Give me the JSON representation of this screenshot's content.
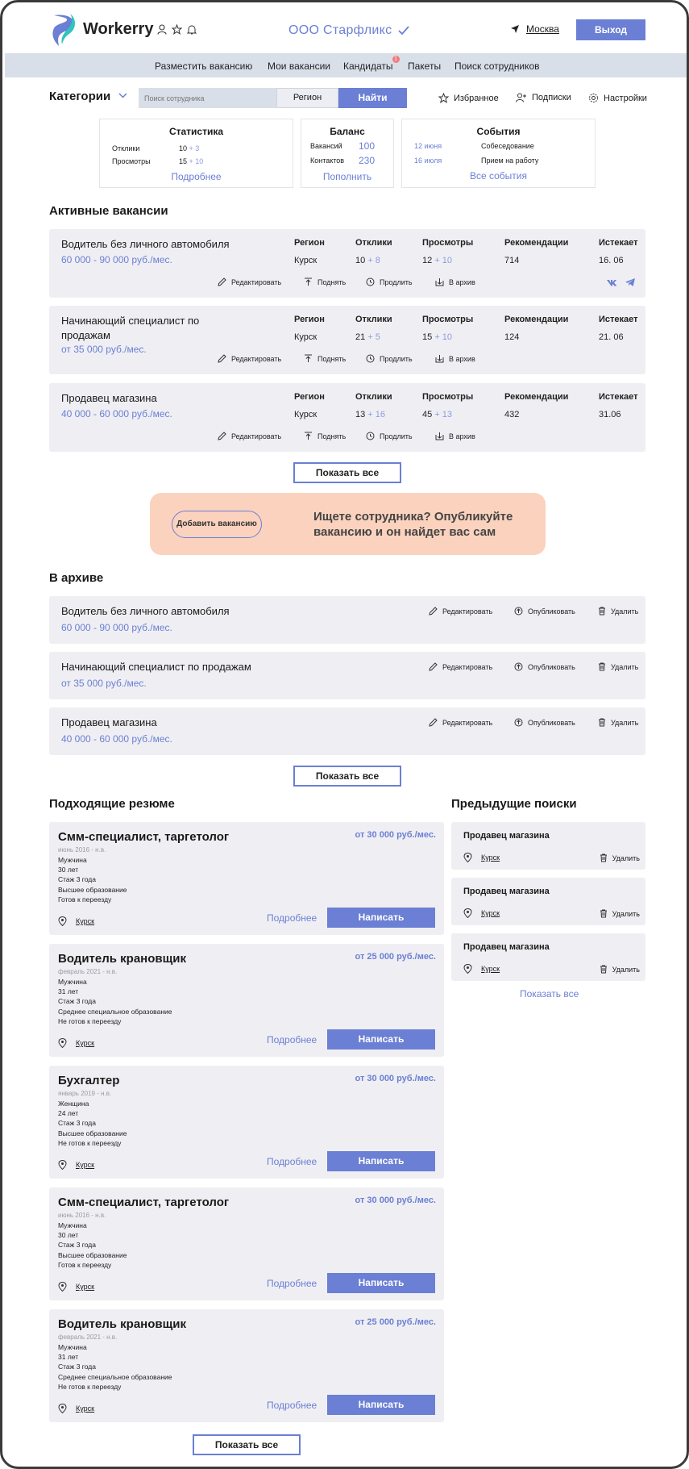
{
  "header": {
    "logo_text": "Workerry",
    "company": "ООО Старфликс",
    "city": "Москва",
    "exit_label": "Выход"
  },
  "nav": [
    "Разместить вакансию",
    "Мои вакансии",
    "Кандидаты",
    "Пакеты",
    "Поиск сотрудников"
  ],
  "nav_badge": "1",
  "search": {
    "categories_label": "Категории",
    "placeholder": "Поиск сотрудника",
    "region_label": "Регион",
    "find_label": "Найти",
    "favorites": "Избранное",
    "subscriptions": "Подписки",
    "settings": "Настройки"
  },
  "stats": {
    "title": "Статистика",
    "rows": [
      {
        "label": "Отклики",
        "value": "10",
        "delta": "+ 3"
      },
      {
        "label": "Просмотры",
        "value": "15",
        "delta": "+ 10"
      }
    ],
    "link": "Подробнее"
  },
  "balance": {
    "title": "Баланс",
    "rows": [
      {
        "label": "Вакансий",
        "value": "100"
      },
      {
        "label": "Контактов",
        "value": "230"
      }
    ],
    "link": "Пополнить"
  },
  "events": {
    "title": "События",
    "rows": [
      {
        "date": "12 июня",
        "name": "Собеседование"
      },
      {
        "date": "16 июля",
        "name": "Прием на работу"
      }
    ],
    "link": "Все события"
  },
  "active": {
    "title": "Активные вакансии",
    "columns": [
      "Регион",
      "Отклики",
      "Просмотры",
      "Рекомендации",
      "Истекает"
    ],
    "actions": [
      "Редактировать",
      "Поднять",
      "Продлить",
      "В архив"
    ],
    "items": [
      {
        "title": "Водитель без личного автомобиля",
        "salary": "60 000 - 90 000 руб./мес.",
        "region": "Курск",
        "responses": "10",
        "responses_delta": "+ 8",
        "views": "12",
        "views_delta": "+ 10",
        "recs": "714",
        "expires": "16. 06"
      },
      {
        "title": "Начинающий специалист по продажам",
        "salary": "от 35 000 руб./мес.",
        "region": "Курск",
        "responses": "21",
        "responses_delta": "+ 5",
        "views": "15",
        "views_delta": "+ 10",
        "recs": "124",
        "expires": "21. 06"
      },
      {
        "title": "Продавец магазина",
        "salary": "40 000 - 60 000 руб./мес.",
        "region": "Курск",
        "responses": "13",
        "responses_delta": "+ 16",
        "views": "45",
        "views_delta": "+ 13",
        "recs": "432",
        "expires": "31.06"
      }
    ],
    "show_all": "Показать все"
  },
  "promo": {
    "button": "Добавить вакансию",
    "text": "Ищете сотрудника? Опубликуйте вакансию и он найдет вас сам"
  },
  "archive": {
    "title": "В архиве",
    "actions": [
      "Редактировать",
      "Опубликовать",
      "Удалить"
    ],
    "items": [
      {
        "title": "Водитель без личного автомобиля",
        "salary": "60 000 - 90 000 руб./мес."
      },
      {
        "title": "Начинающий специалист по продажам",
        "salary": "от 35 000 руб./мес."
      },
      {
        "title": "Продавец магазина",
        "salary": "40 000 - 60 000 руб./мес."
      }
    ],
    "show_all": "Показать все"
  },
  "resumes": {
    "title": "Подходящие резюме",
    "more_label": "Подробнее",
    "write_label": "Написать",
    "items": [
      {
        "title": "Смм-специалист, таргетолог",
        "salary": "от 30 000 руб./мес.",
        "date": "июнь 2016 - н.в.",
        "lines": [
          "Мужчина",
          "30 лет",
          "Стаж 3 года",
          "Высшее образование",
          "Готов к переезду"
        ],
        "city": "Курск"
      },
      {
        "title": "Водитель крановщик",
        "salary": "от 25 000 руб./мес.",
        "date": "февраль 2021 - н.в.",
        "lines": [
          "Мужчина",
          "31 лет",
          "Стаж 3 года",
          "Среднее специальное образование",
          "Не готов к переезду"
        ],
        "city": "Курск"
      },
      {
        "title": "Бухгалтер",
        "salary": "от 30 000 руб./мес.",
        "date": "январь 2019 - н.в.",
        "lines": [
          "Женщина",
          "24 лет",
          "Стаж 3 года",
          "Высшее образование",
          "Не готов к переезду"
        ],
        "city": "Курск"
      },
      {
        "title": "Смм-специалист, таргетолог",
        "salary": "от 30 000 руб./мес.",
        "date": "июнь 2016 - н.в.",
        "lines": [
          "Мужчина",
          "30 лет",
          "Стаж 3 года",
          "Высшее образование",
          "Готов к переезду"
        ],
        "city": "Курск"
      },
      {
        "title": "Водитель крановщик",
        "salary": "от 25 000 руб./мес.",
        "date": "февраль 2021 - н.в.",
        "lines": [
          "Мужчина",
          "31 лет",
          "Стаж 3 года",
          "Среднее специальное образование",
          "Не готов к переезду"
        ],
        "city": "Курск"
      }
    ],
    "show_all": "Показать все"
  },
  "previous": {
    "title": "Предыдущие поиски",
    "delete_label": "Удалить",
    "items": [
      {
        "title": "Продавец магазина",
        "city": "Курск"
      },
      {
        "title": "Продавец магазина",
        "city": "Курск"
      },
      {
        "title": "Продавец магазина",
        "city": "Курск"
      }
    ],
    "show_all": "Показать все"
  },
  "colors": {
    "accent": "#6b7fd4",
    "navbar": "#d9dfe9",
    "card": "#efeff3",
    "promo": "#fbd2bd",
    "badge": "#f07a7a"
  }
}
